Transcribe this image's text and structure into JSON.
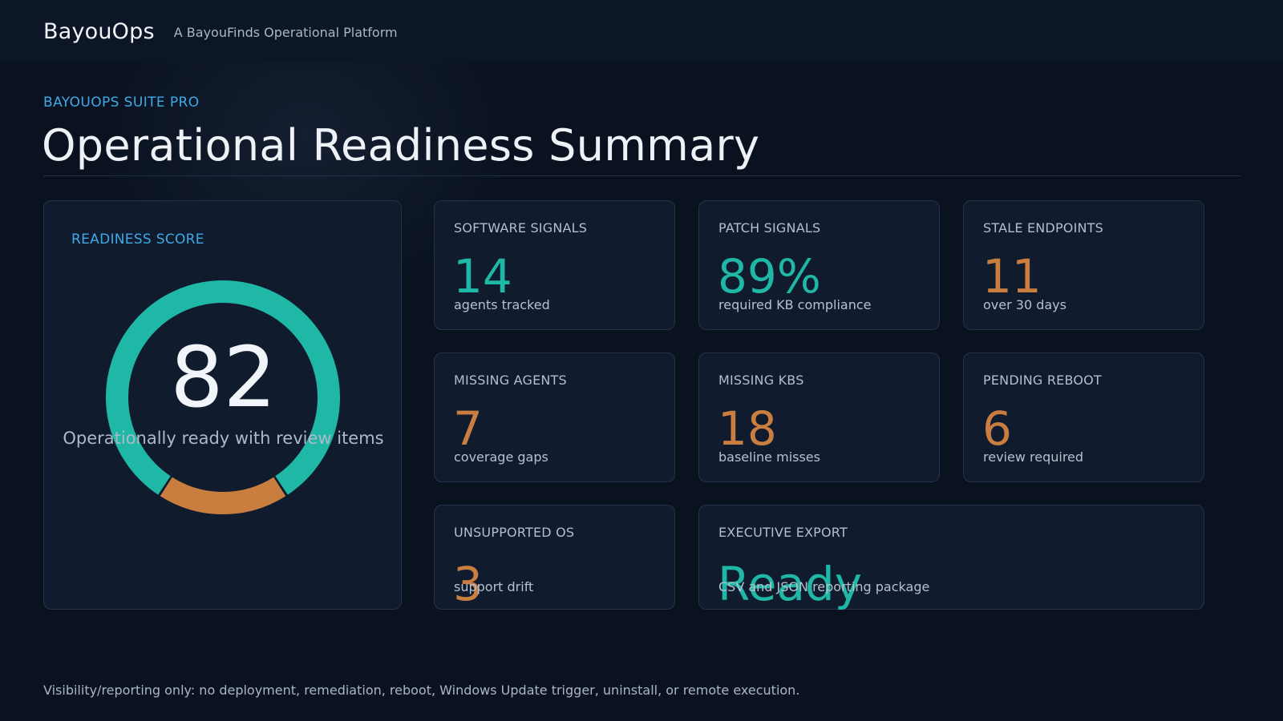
{
  "header": {
    "brand": "BayouOps",
    "tagline": "A BayouFinds Operational Platform"
  },
  "hero": {
    "kicker": "BAYOUOPS SUITE PRO",
    "title": "Operational Readiness Summary"
  },
  "score": {
    "label": "READINESS SCORE",
    "value": "82",
    "caption": "Operationally ready with review items",
    "gauge_fraction": 0.82,
    "colors": {
      "ready": "#1fb7a6",
      "review": "#c97d3f"
    }
  },
  "cards": [
    {
      "label": "SOFTWARE SIGNALS",
      "value": "14",
      "sub": "agents tracked"
    },
    {
      "label": "PATCH SIGNALS",
      "value": "89%",
      "sub": "required KB compliance"
    },
    {
      "label": "STALE ENDPOINTS",
      "value": "11",
      "sub": "over 30 days"
    },
    {
      "label": "MISSING AGENTS",
      "value": "7",
      "sub": "coverage gaps"
    },
    {
      "label": "MISSING KBS",
      "value": "18",
      "sub": "baseline misses"
    },
    {
      "label": "PENDING REBOOT",
      "value": "6",
      "sub": "review required"
    },
    {
      "label": "UNSUPPORTED OS",
      "value": "3",
      "sub": "support drift"
    },
    {
      "label": "EXECUTIVE EXPORT",
      "value": "Ready",
      "sub": "CSV and JSON reporting package"
    }
  ],
  "footer": {
    "note": "Visibility/reporting only: no deployment, remediation, reboot, Windows Update trigger, uninstall, or remote execution."
  }
}
